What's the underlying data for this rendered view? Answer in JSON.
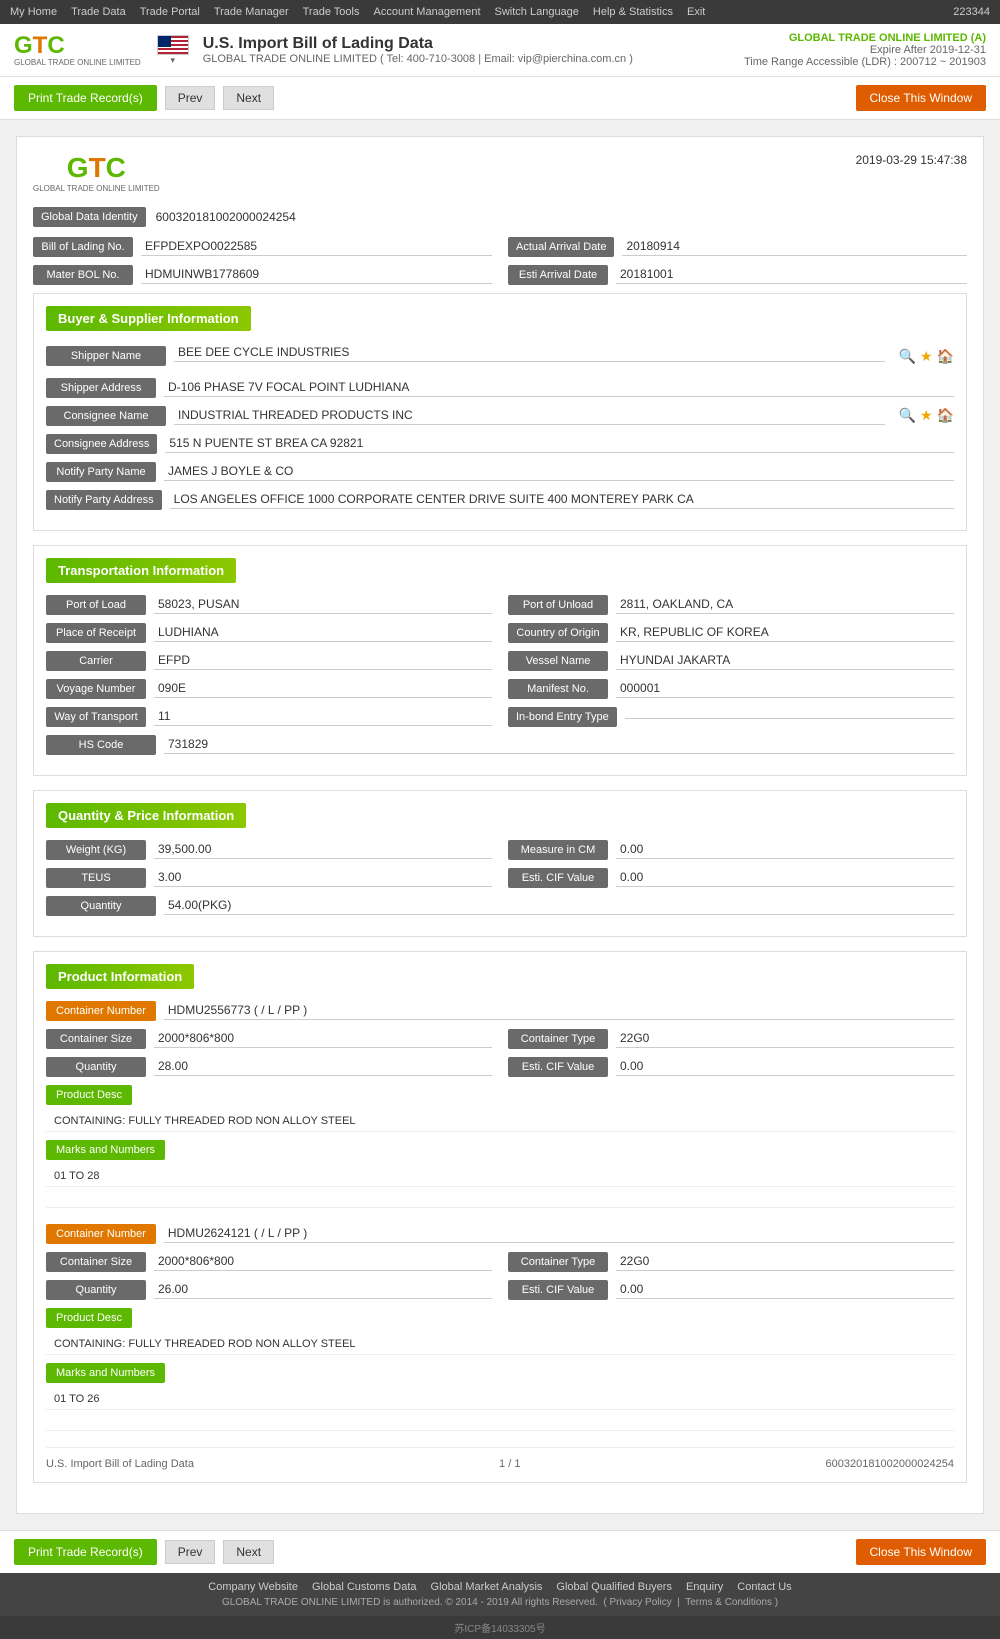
{
  "topnav": {
    "user_id": "223344",
    "items": [
      "My Home",
      "Trade Data",
      "Trade Portal",
      "Trade Manager",
      "Trade Tools",
      "Account Management",
      "Switch Language",
      "Help & Statistics",
      "Exit"
    ]
  },
  "header": {
    "logo_main": "GTC",
    "logo_sub": "GLOBAL TRADE ONLINE LIMITED",
    "flag_alt": "US Flag",
    "title": "U.S. Import Bill of Lading Data",
    "subtitle": "GLOBAL TRADE ONLINE LIMITED ( Tel: 400-710-3008 | Email: vip@pierchina.com.cn )",
    "company_name": "GLOBAL TRADE ONLINE LIMITED (A)",
    "expire": "Expire After 2019-12-31",
    "time_range": "Time Range Accessible (LDR) : 200712 ~ 201903"
  },
  "actions": {
    "print_label": "Print Trade Record(s)",
    "prev_label": "Prev",
    "next_label": "Next",
    "close_label": "Close This Window"
  },
  "record": {
    "date": "2019-03-29 15:47:38",
    "global_data_identity_label": "Global Data Identity",
    "global_data_identity_value": "600320181002000024254",
    "bill_of_lading_label": "Bill of Lading No.",
    "bill_of_lading_value": "EFPDEXPO0022585",
    "actual_arrival_date_label": "Actual Arrival Date",
    "actual_arrival_date_value": "20180914",
    "master_bol_label": "Mater BOL No.",
    "master_bol_value": "HDMUINWB1778609",
    "esti_arrival_date_label": "Esti Arrival Date",
    "esti_arrival_date_value": "20181001"
  },
  "buyer_supplier": {
    "section_title": "Buyer & Supplier Information",
    "shipper_name_label": "Shipper Name",
    "shipper_name_value": "BEE DEE CYCLE INDUSTRIES",
    "shipper_address_label": "Shipper Address",
    "shipper_address_value": "D-106 PHASE 7V FOCAL POINT LUDHIANA",
    "consignee_name_label": "Consignee Name",
    "consignee_name_value": "INDUSTRIAL THREADED PRODUCTS INC",
    "consignee_address_label": "Consignee Address",
    "consignee_address_value": "515 N PUENTE ST BREA CA 92821",
    "notify_party_name_label": "Notify Party Name",
    "notify_party_name_value": "JAMES J BOYLE & CO",
    "notify_party_address_label": "Notify Party Address",
    "notify_party_address_value": "LOS ANGELES OFFICE 1000 CORPORATE CENTER DRIVE SUITE 400 MONTEREY PARK CA"
  },
  "transportation": {
    "section_title": "Transportation Information",
    "port_of_load_label": "Port of Load",
    "port_of_load_value": "58023, PUSAN",
    "port_of_unload_label": "Port of Unload",
    "port_of_unload_value": "2811, OAKLAND, CA",
    "place_of_receipt_label": "Place of Receipt",
    "place_of_receipt_value": "LUDHIANA",
    "country_of_origin_label": "Country of Origin",
    "country_of_origin_value": "KR, REPUBLIC OF KOREA",
    "carrier_label": "Carrier",
    "carrier_value": "EFPD",
    "vessel_name_label": "Vessel Name",
    "vessel_name_value": "HYUNDAI JAKARTA",
    "voyage_number_label": "Voyage Number",
    "voyage_number_value": "090E",
    "manifest_no_label": "Manifest No.",
    "manifest_no_value": "000001",
    "way_of_transport_label": "Way of Transport",
    "way_of_transport_value": "11",
    "inbond_entry_type_label": "In-bond Entry Type",
    "inbond_entry_type_value": "",
    "hs_code_label": "HS Code",
    "hs_code_value": "731829"
  },
  "quantity_price": {
    "section_title": "Quantity & Price Information",
    "weight_kg_label": "Weight (KG)",
    "weight_kg_value": "39,500.00",
    "measure_in_cm_label": "Measure in CM",
    "measure_in_cm_value": "0.00",
    "teus_label": "TEUS",
    "teus_value": "3.00",
    "esti_cif_value_label": "Esti. CIF Value",
    "esti_cif_value_value": "0.00",
    "quantity_label": "Quantity",
    "quantity_value": "54.00(PKG)"
  },
  "product_information": {
    "section_title": "Product Information",
    "containers": [
      {
        "container_number_label": "Container Number",
        "container_number_value": "HDMU2556773 ( / L / PP )",
        "container_size_label": "Container Size",
        "container_size_value": "2000*806*800",
        "container_type_label": "Container Type",
        "container_type_value": "22G0",
        "quantity_label": "Quantity",
        "quantity_value": "28.00",
        "esti_cif_value_label": "Esti. CIF Value",
        "esti_cif_value_value": "0.00",
        "product_desc_label": "Product Desc",
        "product_desc_value": "CONTAINING: FULLY THREADED ROD NON ALLOY STEEL",
        "marks_and_numbers_label": "Marks and Numbers",
        "marks_and_numbers_value": "01 TO 28"
      },
      {
        "container_number_label": "Container Number",
        "container_number_value": "HDMU2624121 ( / L / PP )",
        "container_size_label": "Container Size",
        "container_size_value": "2000*806*800",
        "container_type_label": "Container Type",
        "container_type_value": "22G0",
        "quantity_label": "Quantity",
        "quantity_value": "26.00",
        "esti_cif_value_label": "Esti. CIF Value",
        "esti_cif_value_value": "0.00",
        "product_desc_label": "Product Desc",
        "product_desc_value": "CONTAINING: FULLY THREADED ROD NON ALLOY STEEL",
        "marks_and_numbers_label": "Marks and Numbers",
        "marks_and_numbers_value": "01 TO 26"
      }
    ]
  },
  "record_footer": {
    "left": "U.S. Import Bill of Lading Data",
    "center": "1 / 1",
    "right": "600320181002000024254"
  },
  "footer": {
    "links": [
      "Company Website",
      "Global Customs Data",
      "Global Market Analysis",
      "Global Qualified Buyers",
      "Enquiry",
      "Contact Us"
    ],
    "copyright": "GLOBAL TRADE ONLINE LIMITED is authorized. © 2014 - 2019 All rights Reserved.",
    "privacy": "Privacy Policy",
    "terms": "Terms & Conditions",
    "icp": "苏ICP备14033305号"
  }
}
